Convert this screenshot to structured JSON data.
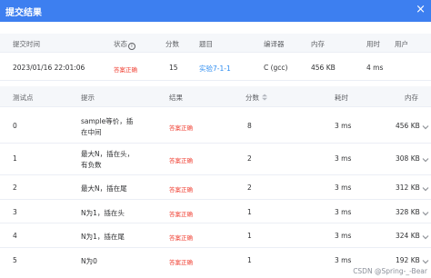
{
  "dialog": {
    "title": "提交结果",
    "close_glyph": "×"
  },
  "summary": {
    "headers": {
      "time": "提交时间",
      "status": "状态",
      "score": "分数",
      "problem": "题目",
      "compiler": "编译器",
      "memory": "内存",
      "duration": "用时",
      "user": "用户"
    },
    "row": {
      "time": "2023/01/16 22:01:06",
      "status": "答案正确",
      "score": "15",
      "problem": "实验7-1-1",
      "compiler": "C (gcc)",
      "memory": "456 KB",
      "duration": "4 ms",
      "user": ""
    }
  },
  "tests": {
    "headers": {
      "case": "测试点",
      "hint": "提示",
      "result": "结果",
      "score": "分数",
      "time": "耗时",
      "memory": "内存"
    },
    "rows": [
      {
        "case": "0",
        "hint_line1": "sample等价，插",
        "hint_line2": "在中间",
        "result": "答案正确",
        "score": "8",
        "time": "3 ms",
        "memory": "456 KB"
      },
      {
        "case": "1",
        "hint_line1": "最大N，插在头，",
        "hint_line2": "有负数",
        "result": "答案正确",
        "score": "2",
        "time": "3 ms",
        "memory": "308 KB"
      },
      {
        "case": "2",
        "hint_line1": "最大N，插在尾",
        "hint_line2": "",
        "result": "答案正确",
        "score": "2",
        "time": "3 ms",
        "memory": "312 KB"
      },
      {
        "case": "3",
        "hint_line1": "N为1，插在头",
        "hint_line2": "",
        "result": "答案正确",
        "score": "1",
        "time": "3 ms",
        "memory": "328 KB"
      },
      {
        "case": "4",
        "hint_line1": "N为1，插在尾",
        "hint_line2": "",
        "result": "答案正确",
        "score": "1",
        "time": "3 ms",
        "memory": "324 KB"
      },
      {
        "case": "5",
        "hint_line1": "N为0",
        "hint_line2": "",
        "result": "答案正确",
        "score": "1",
        "time": "3 ms",
        "memory": "192 KB"
      }
    ]
  },
  "watermark": "CSDN @Spring-_-Bear",
  "colors": {
    "header_bg": "#3d7ff0",
    "accepted": "#f04134",
    "link": "#2d8cf0"
  },
  "icons": {
    "info": "info-circle-icon",
    "sort": "sort-icon",
    "expand": "chevron-down-icon",
    "close": "close-icon"
  }
}
